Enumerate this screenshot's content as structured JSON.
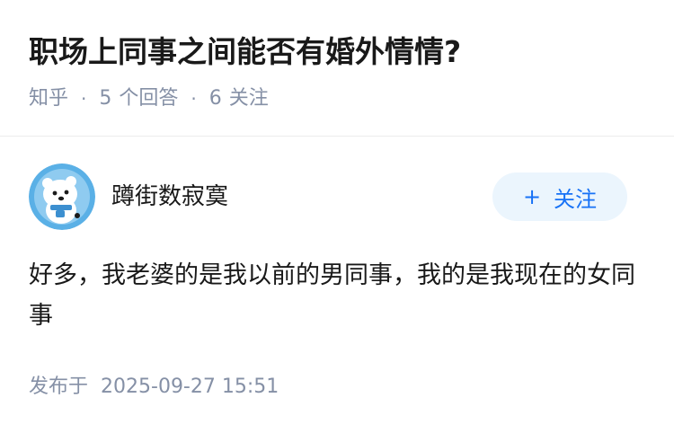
{
  "question": {
    "title": "职场上同事之间能否有婚外情情?",
    "source": "知乎",
    "answer_count": "5",
    "answer_label": "个回答",
    "follower_count": "6",
    "follower_label": "关注",
    "separator": "·"
  },
  "author": {
    "name": "蹲街数寂寞",
    "avatar_icon": "polar-bear-avatar-icon"
  },
  "follow": {
    "plus": "+",
    "label": "关注"
  },
  "answer": {
    "content": "好多，我老婆的是我以前的男同事，我的是我现在的女同事",
    "published_label": "发布于",
    "published_time": "2025-09-27 15:51"
  },
  "colors": {
    "accent": "#1772f6",
    "accent_bg": "#ebf5fd",
    "meta_text": "#8590a6",
    "avatar_bg": "#5ab0e6"
  }
}
